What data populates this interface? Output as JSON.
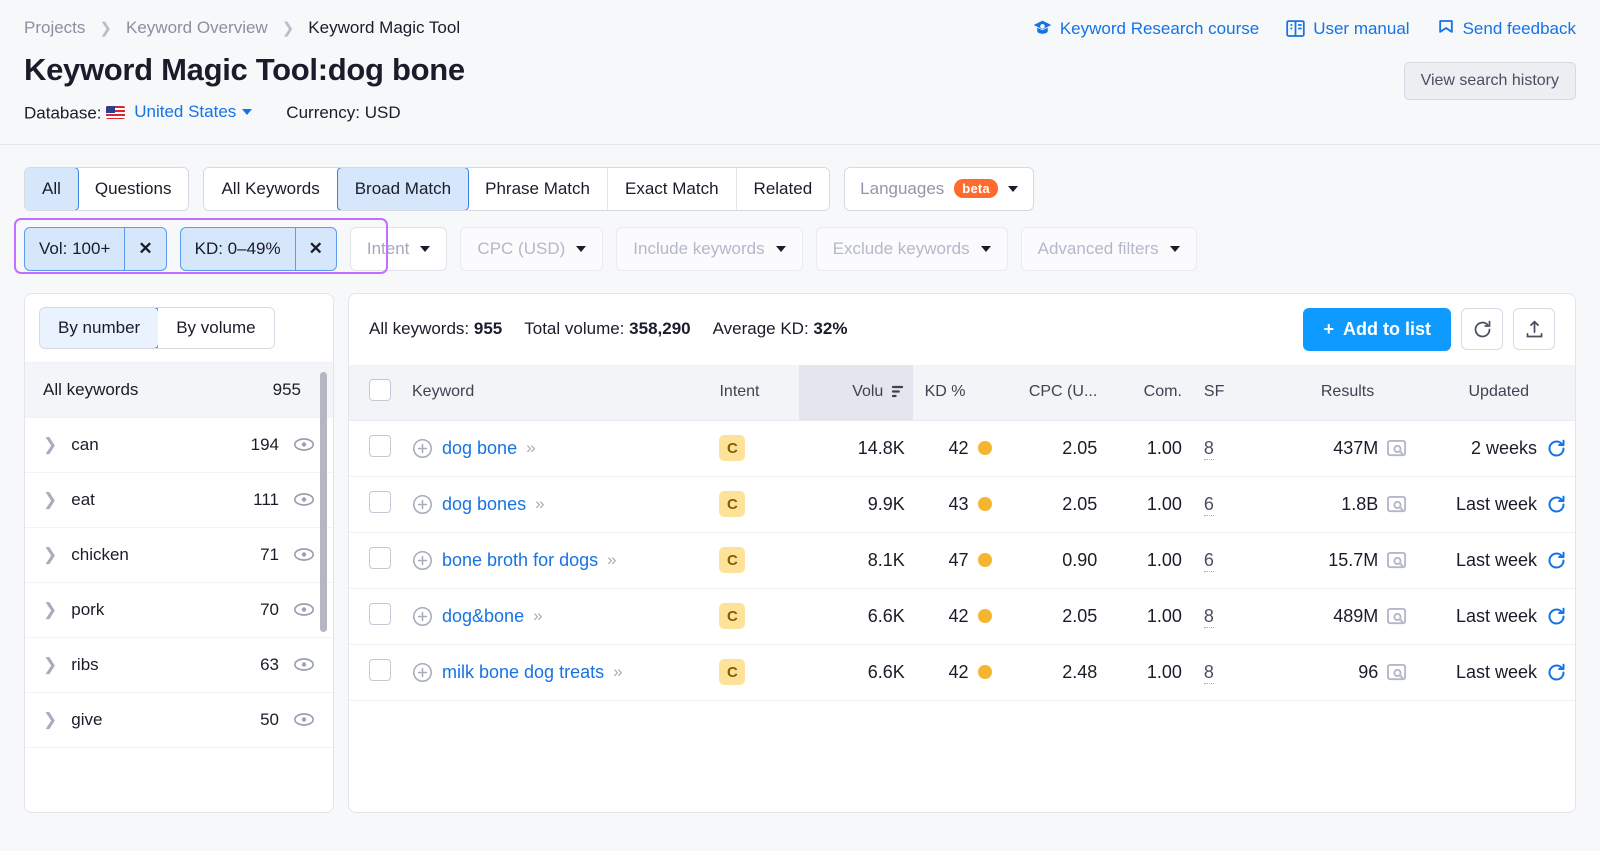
{
  "breadcrumb": [
    {
      "label": "Projects",
      "current": false
    },
    {
      "label": "Keyword Overview",
      "current": false
    },
    {
      "label": "Keyword Magic Tool",
      "current": true
    }
  ],
  "header_links": [
    {
      "label": "Keyword Research course",
      "icon": "graduation-cap-icon"
    },
    {
      "label": "User manual",
      "icon": "book-icon"
    },
    {
      "label": "Send feedback",
      "icon": "flag-icon"
    }
  ],
  "page": {
    "title": "Keyword Magic Tool:",
    "term": "dog bone",
    "history_button": "View search history",
    "database_label": "Database:",
    "database_value": "United States",
    "currency_label": "Currency:",
    "currency_value": "USD"
  },
  "filters": {
    "scope_tabs": [
      {
        "label": "All",
        "active": true
      },
      {
        "label": "Questions",
        "active": false
      }
    ],
    "match_tabs": [
      {
        "label": "All Keywords",
        "active": false
      },
      {
        "label": "Broad Match",
        "active": true
      },
      {
        "label": "Phrase Match",
        "active": false
      },
      {
        "label": "Exact Match",
        "active": false
      },
      {
        "label": "Related",
        "active": false
      }
    ],
    "languages": {
      "label": "Languages",
      "badge": "beta"
    },
    "chips": [
      {
        "label": "Vol: 100+",
        "close": "✕"
      },
      {
        "label": "KD: 0–49%",
        "close": "✕"
      }
    ],
    "dropdowns": [
      {
        "label": "Intent",
        "muted": false
      },
      {
        "label": "CPC (USD)",
        "muted": true
      },
      {
        "label": "Include keywords",
        "muted": true
      },
      {
        "label": "Exclude keywords",
        "muted": true
      },
      {
        "label": "Advanced filters",
        "muted": true
      }
    ]
  },
  "sidebar": {
    "toggle": [
      {
        "label": "By number",
        "active": true
      },
      {
        "label": "By volume",
        "active": false
      }
    ],
    "all_row": {
      "label": "All keywords",
      "count": "955"
    },
    "groups": [
      {
        "label": "can",
        "count": "194"
      },
      {
        "label": "eat",
        "count": "111"
      },
      {
        "label": "chicken",
        "count": "71"
      },
      {
        "label": "pork",
        "count": "70"
      },
      {
        "label": "ribs",
        "count": "63"
      },
      {
        "label": "give",
        "count": "50"
      }
    ]
  },
  "stats": {
    "all_keywords_label": "All keywords:",
    "all_keywords_value": "955",
    "total_volume_label": "Total volume:",
    "total_volume_value": "358,290",
    "average_kd_label": "Average KD:",
    "average_kd_value": "32%",
    "add_to_list": "Add to list",
    "add_icon": "plus-icon",
    "refresh_icon": "refresh-icon",
    "export_icon": "export-icon"
  },
  "table": {
    "columns": {
      "keyword": "Keyword",
      "intent": "Intent",
      "volume": "Volu",
      "kd": "KD %",
      "cpc": "CPC (U...",
      "com": "Com.",
      "sf": "SF",
      "results": "Results",
      "updated": "Updated"
    },
    "rows": [
      {
        "keyword": "dog bone",
        "intent": "C",
        "volume": "14.8K",
        "kd": "42",
        "cpc": "2.05",
        "com": "1.00",
        "sf": "8",
        "results": "437M",
        "updated": "2 weeks"
      },
      {
        "keyword": "dog bones",
        "intent": "C",
        "volume": "9.9K",
        "kd": "43",
        "cpc": "2.05",
        "com": "1.00",
        "sf": "6",
        "results": "1.8B",
        "updated": "Last week"
      },
      {
        "keyword": "bone broth for dogs",
        "intent": "C",
        "volume": "8.1K",
        "kd": "47",
        "cpc": "0.90",
        "com": "1.00",
        "sf": "6",
        "results": "15.7M",
        "updated": "Last week"
      },
      {
        "keyword": "dog&bone",
        "intent": "C",
        "volume": "6.6K",
        "kd": "42",
        "cpc": "2.05",
        "com": "1.00",
        "sf": "8",
        "results": "489M",
        "updated": "Last week"
      },
      {
        "keyword": "milk bone dog treats",
        "intent": "C",
        "volume": "6.6K",
        "kd": "42",
        "cpc": "2.48",
        "com": "1.00",
        "sf": "8",
        "results": "96",
        "updated": "Last week"
      }
    ]
  },
  "colors": {
    "accent_blue": "#1573e6",
    "primary_button": "#0e9aff",
    "chip_bg": "#d6e6fb",
    "highlight_purple": "#c46dff",
    "intent_badge": "#fde29a",
    "kd_dot": "#f5b62f",
    "beta_badge": "#ff6b2c"
  }
}
